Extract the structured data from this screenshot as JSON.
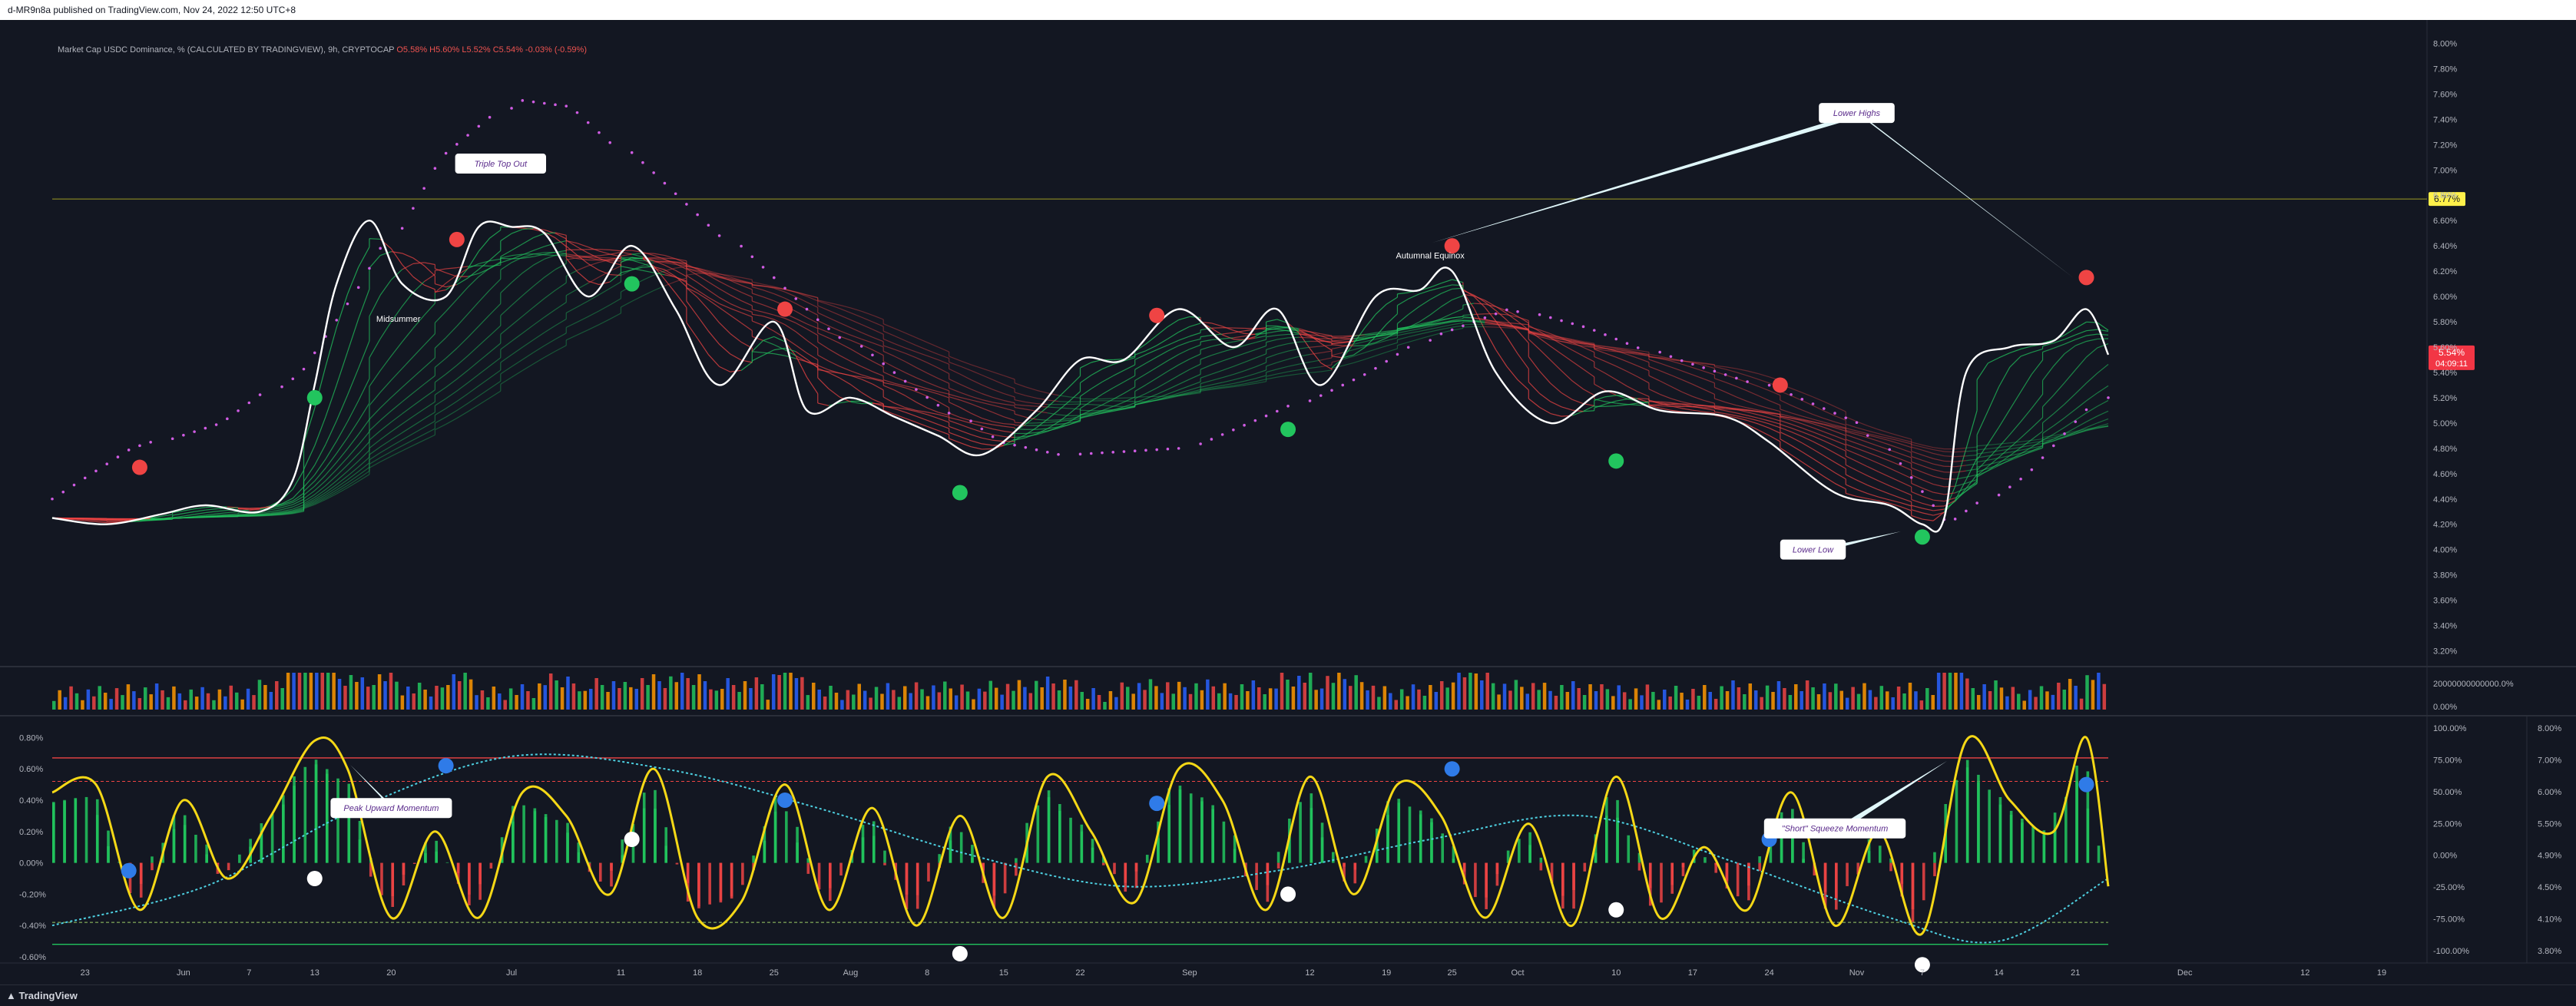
{
  "header": {
    "published": "d-MR9n8a published on TradingView.com, Nov 24, 2022 12:50 UTC+8"
  },
  "legend": {
    "title": "Market Cap USDC Dominance, % (CALCULATED BY TRADINGVIEW), 9h, CRYPTOCAP",
    "ohlc": "O5.58% H5.60% L5.52% C5.54% -0.03% (-0.59%)"
  },
  "footer": {
    "brand": "TradingView"
  },
  "colors": {
    "background": "#131722",
    "bull": "#22c55e",
    "bear": "#ef4444",
    "osc_line": "#f5d816",
    "signal": "#4dd0e1",
    "sar": "#d05ce3",
    "price": "#ffffff",
    "price_tag": "#f23645",
    "level_tag": "#fff04a"
  },
  "chart_data": [
    {
      "type": "line",
      "name": "price",
      "title": "Market Cap USDC Dominance, %",
      "ylim": [
        3.1,
        8.1
      ],
      "ticks": [
        "8.00%",
        "7.80%",
        "7.60%",
        "7.40%",
        "7.20%",
        "7.00%",
        "6.80%",
        "6.60%",
        "6.40%",
        "6.20%",
        "6.00%",
        "5.80%",
        "5.60%",
        "5.40%",
        "5.20%",
        "5.00%",
        "4.80%",
        "4.60%",
        "4.40%",
        "4.20%",
        "4.00%",
        "3.80%",
        "3.60%",
        "3.40%",
        "3.20%"
      ],
      "tick_values": [
        8.0,
        7.8,
        7.6,
        7.4,
        7.2,
        7.0,
        6.8,
        6.6,
        6.4,
        6.2,
        6.0,
        5.8,
        5.6,
        5.4,
        5.2,
        5.0,
        4.8,
        4.6,
        4.4,
        4.2,
        4.0,
        3.8,
        3.6,
        3.4,
        3.2
      ],
      "x": [
        "2022-05-20",
        "2022-05-25",
        "2022-05-30",
        "2022-06-03",
        "2022-06-08",
        "2022-06-11",
        "2022-06-13",
        "2022-06-15",
        "2022-06-18",
        "2022-06-21",
        "2022-06-25",
        "2022-06-28",
        "2022-07-01",
        "2022-07-04",
        "2022-07-08",
        "2022-07-12",
        "2022-07-16",
        "2022-07-20",
        "2022-07-25",
        "2022-07-28",
        "2022-08-01",
        "2022-08-05",
        "2022-08-09",
        "2022-08-13",
        "2022-08-18",
        "2022-08-22",
        "2022-08-26",
        "2022-08-31",
        "2022-09-05",
        "2022-09-09",
        "2022-09-13",
        "2022-09-18",
        "2022-09-22",
        "2022-09-25",
        "2022-09-29",
        "2022-10-04",
        "2022-10-09",
        "2022-10-14",
        "2022-10-20",
        "2022-10-24",
        "2022-10-30",
        "2022-11-04",
        "2022-11-07",
        "2022-11-09",
        "2022-11-11",
        "2022-11-15",
        "2022-11-19",
        "2022-11-22",
        "2022-11-24"
      ],
      "y": [
        4.25,
        4.2,
        4.28,
        4.35,
        4.3,
        4.55,
        5.3,
        6.1,
        6.6,
        6.1,
        6.0,
        6.55,
        6.55,
        6.5,
        6.0,
        6.4,
        5.9,
        5.3,
        5.8,
        5.1,
        5.2,
        5.05,
        4.9,
        4.75,
        5.1,
        5.5,
        5.5,
        5.9,
        5.6,
        5.9,
        5.3,
        6.0,
        6.05,
        6.2,
        5.4,
        5.0,
        5.25,
        5.1,
        5.05,
        4.85,
        4.45,
        4.35,
        4.2,
        4.25,
        5.4,
        5.6,
        5.65,
        5.9,
        5.54
      ],
      "last_price": "5.54%",
      "countdown": "04:09:11",
      "level": {
        "label": "6.77%",
        "value": 6.77
      },
      "sar": {
        "x": [
          "2022-05-20",
          "2022-05-28",
          "2022-06-05",
          "2022-06-12",
          "2022-06-18",
          "2022-06-25",
          "2022-07-02",
          "2022-07-07",
          "2022-07-14",
          "2022-07-22",
          "2022-07-30",
          "2022-08-07",
          "2022-08-15",
          "2022-08-21",
          "2022-09-01",
          "2022-09-10",
          "2022-09-18",
          "2022-09-24",
          "2022-10-01",
          "2022-10-08",
          "2022-10-16",
          "2022-10-24",
          "2022-11-02",
          "2022-11-10",
          "2022-11-17",
          "2022-11-24"
        ],
        "y": [
          4.4,
          4.8,
          5.0,
          5.4,
          6.1,
          7.1,
          7.55,
          7.5,
          7.0,
          6.4,
          5.8,
          5.3,
          4.85,
          4.75,
          4.8,
          5.1,
          5.4,
          5.7,
          5.9,
          5.75,
          5.5,
          5.3,
          5.0,
          4.2,
          4.6,
          5.2
        ]
      },
      "markers": [
        {
          "x": "2022-05-28",
          "y": 4.65,
          "kind": "sell"
        },
        {
          "x": "2022-06-13",
          "y": 5.2,
          "kind": "buy"
        },
        {
          "x": "2022-06-26",
          "y": 6.45,
          "kind": "sell"
        },
        {
          "x": "2022-07-12",
          "y": 6.1,
          "kind": "buy"
        },
        {
          "x": "2022-07-26",
          "y": 5.9,
          "kind": "sell"
        },
        {
          "x": "2022-08-11",
          "y": 4.45,
          "kind": "buy"
        },
        {
          "x": "2022-08-29",
          "y": 5.85,
          "kind": "sell"
        },
        {
          "x": "2022-09-10",
          "y": 4.95,
          "kind": "buy"
        },
        {
          "x": "2022-09-25",
          "y": 6.4,
          "kind": "sell"
        },
        {
          "x": "2022-10-10",
          "y": 4.7,
          "kind": "buy"
        },
        {
          "x": "2022-10-25",
          "y": 5.3,
          "kind": "sell"
        },
        {
          "x": "2022-11-07",
          "y": 4.1,
          "kind": "buy"
        },
        {
          "x": "2022-11-22",
          "y": 6.15,
          "kind": "sell"
        }
      ],
      "annotations": [
        {
          "text": "Triple Top Out",
          "x": "2022-06-30",
          "y": 7.05
        },
        {
          "text": "Lower Highs",
          "x": "2022-11-01",
          "y": 7.45
        },
        {
          "text": "Lower Low",
          "x": "2022-10-28",
          "y": 4.0
        },
        {
          "text": "Midsummer",
          "x": "2022-06-21",
          "y": 5.8
        },
        {
          "text": "Autumnal Equinox",
          "x": "2022-09-23",
          "y": 6.3
        }
      ]
    },
    {
      "type": "bar",
      "name": "volume",
      "ticks": [
        "20000000000000.0%",
        "0.00%"
      ]
    },
    {
      "type": "line",
      "name": "oscillator",
      "ylim": [
        -0.6,
        0.9
      ],
      "ticks_left": [
        "0.80%",
        "0.60%",
        "0.40%",
        "0.20%",
        "0.00%",
        "-0.20%",
        "-0.40%",
        "-0.60%"
      ],
      "ticks_left_values": [
        0.8,
        0.6,
        0.4,
        0.2,
        0.0,
        -0.2,
        -0.4,
        -0.6
      ],
      "ticks_mid": [
        "100.00%",
        "75.00%",
        "50.00%",
        "25.00%",
        "0.00%",
        "-25.00%",
        "-75.00%",
        "-100.00%"
      ],
      "ticks_right": [
        "8.00%",
        "7.00%",
        "6.00%",
        "5.50%",
        "4.90%",
        "4.50%",
        "4.10%",
        "3.80%"
      ],
      "ticks_right_values": [
        8.0,
        7.0,
        6.0,
        5.5,
        4.9,
        4.5,
        4.1,
        3.8
      ],
      "upper_band": 0.67,
      "upper_band2": 0.52,
      "lower_band": -0.38,
      "lower_band2": -0.52,
      "x": [
        "2022-05-20",
        "2022-05-24",
        "2022-05-28",
        "2022-06-01",
        "2022-06-05",
        "2022-06-09",
        "2022-06-13",
        "2022-06-16",
        "2022-06-20",
        "2022-06-24",
        "2022-06-28",
        "2022-07-02",
        "2022-07-06",
        "2022-07-10",
        "2022-07-14",
        "2022-07-18",
        "2022-07-22",
        "2022-07-26",
        "2022-07-30",
        "2022-08-03",
        "2022-08-07",
        "2022-08-11",
        "2022-08-15",
        "2022-08-19",
        "2022-08-23",
        "2022-08-27",
        "2022-08-31",
        "2022-09-04",
        "2022-09-08",
        "2022-09-12",
        "2022-09-16",
        "2022-09-20",
        "2022-09-24",
        "2022-09-28",
        "2022-10-02",
        "2022-10-06",
        "2022-10-10",
        "2022-10-14",
        "2022-10-18",
        "2022-10-22",
        "2022-10-26",
        "2022-10-30",
        "2022-11-03",
        "2022-11-07",
        "2022-11-11",
        "2022-11-15",
        "2022-11-19",
        "2022-11-22",
        "2022-11-24"
      ],
      "y": [
        0.45,
        0.5,
        -0.3,
        0.4,
        -0.1,
        0.3,
        0.78,
        0.6,
        -0.35,
        0.2,
        -0.35,
        0.45,
        0.3,
        -0.2,
        0.6,
        -0.35,
        -0.25,
        0.5,
        -0.3,
        0.35,
        -0.4,
        0.3,
        -0.35,
        0.55,
        0.2,
        -0.25,
        0.6,
        0.4,
        -0.3,
        0.55,
        -0.2,
        0.5,
        0.3,
        -0.35,
        0.25,
        -0.4,
        0.55,
        -0.35,
        0.1,
        -0.3,
        0.45,
        -0.4,
        0.2,
        -0.45,
        0.78,
        0.4,
        0.2,
        0.8,
        -0.15
      ],
      "signal_x": [
        "2022-05-20",
        "2022-06-03",
        "2022-06-17",
        "2022-07-01",
        "2022-07-15",
        "2022-07-29",
        "2022-08-12",
        "2022-08-26",
        "2022-09-09",
        "2022-09-23",
        "2022-10-07",
        "2022-10-21",
        "2022-11-04",
        "2022-11-14",
        "2022-11-24"
      ],
      "signal_y": [
        -0.4,
        -0.15,
        0.35,
        0.68,
        0.6,
        0.35,
        0.05,
        -0.15,
        -0.05,
        0.15,
        0.3,
        0.0,
        -0.35,
        -0.5,
        -0.1
      ],
      "dots": [
        {
          "x": "2022-05-27",
          "y": -0.05,
          "color": "blue"
        },
        {
          "x": "2022-06-13",
          "y": -0.1,
          "color": "white"
        },
        {
          "x": "2022-06-25",
          "y": 0.62,
          "color": "blue"
        },
        {
          "x": "2022-07-12",
          "y": 0.15,
          "color": "white"
        },
        {
          "x": "2022-07-26",
          "y": 0.4,
          "color": "blue"
        },
        {
          "x": "2022-08-11",
          "y": -0.58,
          "color": "white"
        },
        {
          "x": "2022-08-29",
          "y": 0.38,
          "color": "blue"
        },
        {
          "x": "2022-09-10",
          "y": -0.2,
          "color": "white"
        },
        {
          "x": "2022-09-25",
          "y": 0.6,
          "color": "blue"
        },
        {
          "x": "2022-10-10",
          "y": -0.3,
          "color": "white"
        },
        {
          "x": "2022-10-24",
          "y": 0.15,
          "color": "blue"
        },
        {
          "x": "2022-11-07",
          "y": -0.65,
          "color": "white"
        },
        {
          "x": "2022-11-22",
          "y": 0.5,
          "color": "blue"
        }
      ],
      "annotations": [
        {
          "text": "Peak Upward Momentum",
          "x": "2022-06-20",
          "y": 0.35
        },
        {
          "text": "\"Short\" Squeeze Momentum",
          "x": "2022-10-30",
          "y": 0.22
        }
      ]
    }
  ],
  "x_axis": {
    "labels": [
      "23",
      "Jun",
      "7",
      "13",
      "20",
      "Jul",
      "11",
      "18",
      "25",
      "Aug",
      "8",
      "15",
      "22",
      "Sep",
      "12",
      "19",
      "25",
      "Oct",
      "10",
      "17",
      "24",
      "Nov",
      "7",
      "14",
      "21",
      "Dec",
      "12",
      "19"
    ],
    "dates": [
      "2022-05-23",
      "2022-06-01",
      "2022-06-07",
      "2022-06-13",
      "2022-06-20",
      "2022-07-01",
      "2022-07-11",
      "2022-07-18",
      "2022-07-25",
      "2022-08-01",
      "2022-08-08",
      "2022-08-15",
      "2022-08-22",
      "2022-09-01",
      "2022-09-12",
      "2022-09-19",
      "2022-09-25",
      "2022-10-01",
      "2022-10-10",
      "2022-10-17",
      "2022-10-24",
      "2022-11-01",
      "2022-11-07",
      "2022-11-14",
      "2022-11-21",
      "2022-12-01",
      "2022-12-12",
      "2022-12-19"
    ]
  }
}
